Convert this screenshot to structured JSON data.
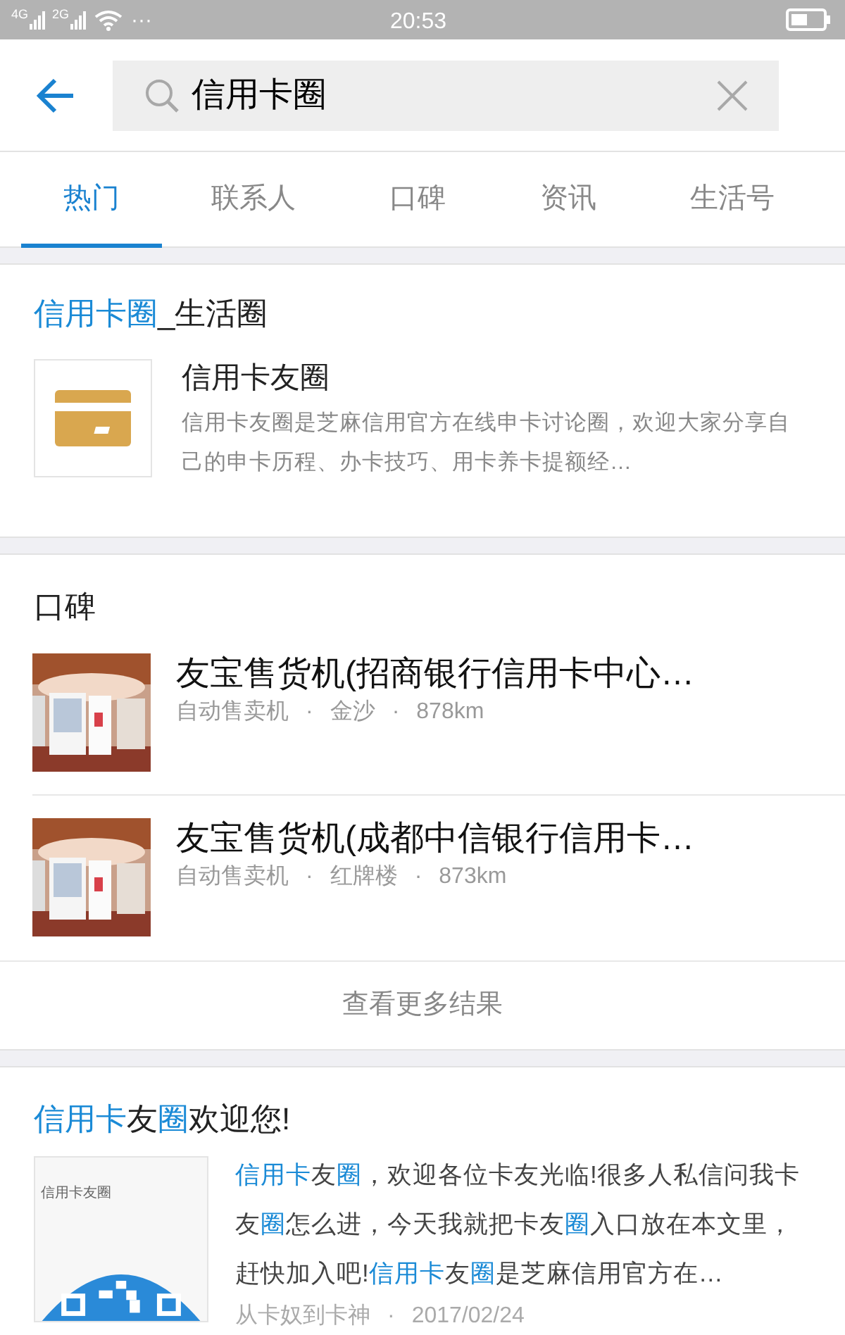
{
  "status_bar": {
    "network_1": "4G",
    "network_2": "2G",
    "more": "···",
    "time": "20:53"
  },
  "search": {
    "value": "信用卡圈"
  },
  "tabs": [
    {
      "label": "热门",
      "selected": true
    },
    {
      "label": "联系人",
      "selected": false
    },
    {
      "label": "口碑",
      "selected": false
    },
    {
      "label": "资讯",
      "selected": false
    },
    {
      "label": "生活号",
      "selected": false
    }
  ],
  "life_circle": {
    "title": [
      {
        "text": "信用卡圈",
        "highlight": true
      },
      {
        "text": "_生活圈",
        "highlight": false
      }
    ],
    "item": {
      "name": "信用卡友圈",
      "description": "信用卡友圈是芝麻信用官方在线申卡讨论圈，欢迎大家分享自己的申卡历程、办卡技巧、用卡养卡提额经…"
    }
  },
  "koubei": {
    "title": "口碑",
    "items": [
      {
        "name": "友宝售货机(招商银行信用卡中心…",
        "category": "自动售卖机",
        "separator_1": "·",
        "area": "金沙",
        "separator_2": "·",
        "distance": "878km"
      },
      {
        "name": "友宝售货机(成都中信银行信用卡…",
        "category": "自动售卖机",
        "separator_1": "·",
        "area": "红牌楼",
        "separator_2": "·",
        "distance": "873km"
      }
    ],
    "more": "查看更多结果"
  },
  "article": {
    "title": [
      {
        "text": "信用卡",
        "highlight": true
      },
      {
        "text": "友",
        "highlight": false
      },
      {
        "text": "圈",
        "highlight": true
      },
      {
        "text": "欢迎您!",
        "highlight": false
      }
    ],
    "thumbnail_label": "信用卡友圈",
    "summary": [
      {
        "text": "信用卡",
        "highlight": true
      },
      {
        "text": "友",
        "highlight": false
      },
      {
        "text": "圈",
        "highlight": true
      },
      {
        "text": "，欢迎各位卡友光临!很多人私信问我卡友",
        "highlight": false
      },
      {
        "text": "圈",
        "highlight": true
      },
      {
        "text": "怎么进，今天我就把卡友",
        "highlight": false
      },
      {
        "text": "圈",
        "highlight": true
      },
      {
        "text": "入口放在本文里，赶快加入吧!",
        "highlight": false
      },
      {
        "text": "信用卡",
        "highlight": true
      },
      {
        "text": "友",
        "highlight": false
      },
      {
        "text": "圈",
        "highlight": true
      },
      {
        "text": "是芝麻信用官方在…",
        "highlight": false
      }
    ],
    "author": "从卡奴到卡神",
    "separator": "·",
    "date": "2017/02/24"
  }
}
